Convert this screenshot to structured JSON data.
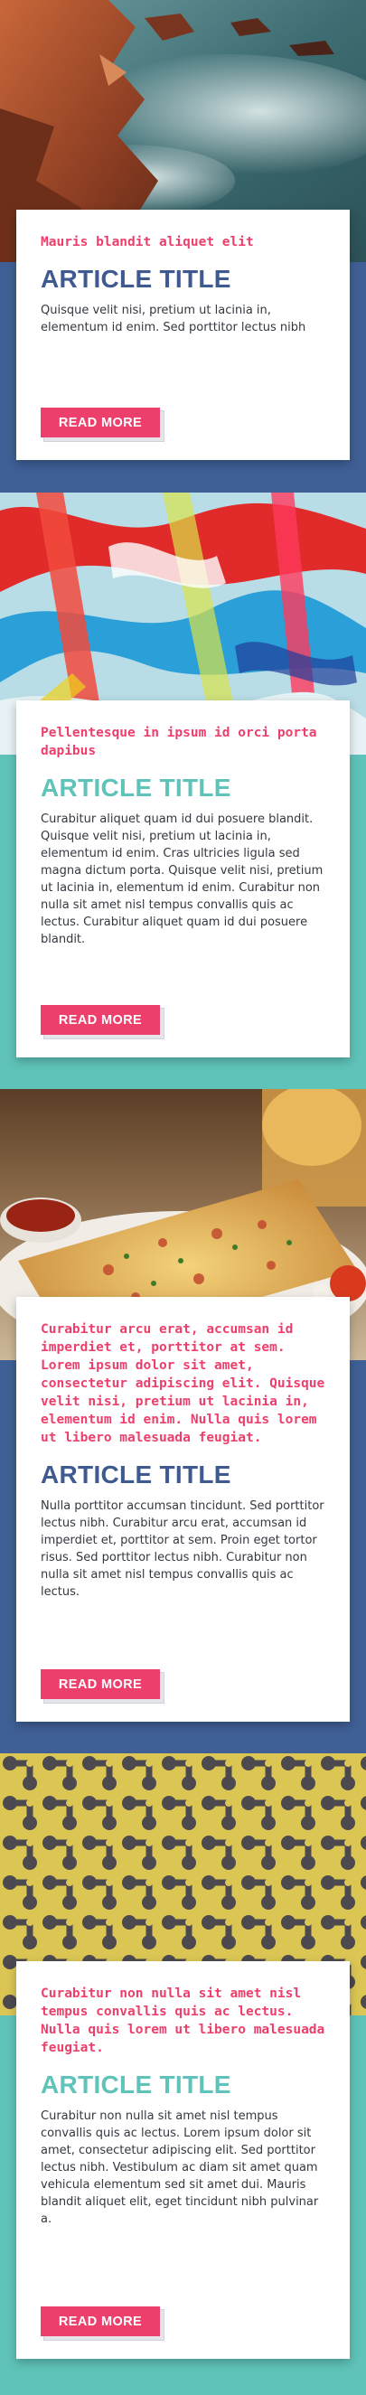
{
  "colors": {
    "navy": "#3f5f96",
    "teal": "#5fc3b9",
    "pink": "#ec3f6b",
    "card": "#ffffff",
    "text": "#333840"
  },
  "articles": [
    {
      "eyebrow": "Mauris blandit aliquet elit",
      "title": "ARTICLE TITLE",
      "body": "Quisque velit nisi, pretium ut lacinia in, elementum id enim. Sed porttitor lectus nibh",
      "button": "READ MORE",
      "image": "coastal-rocks-photo"
    },
    {
      "eyebrow": "Pellentesque in ipsum id orci porta dapibus",
      "title": "ARTICLE TITLE",
      "body": "Curabitur aliquet quam id dui posuere blandit. Quisque velit nisi, pretium ut lacinia in, elementum id enim. Cras ultricies ligula sed magna dictum porta. Quisque velit nisi, pretium ut lacinia in, elementum id enim. Curabitur non nulla sit amet nisl tempus convallis quis ac lectus. Curabitur aliquet quam id dui posuere blandit.",
      "button": "READ MORE",
      "image": "abstract-paint-photo"
    },
    {
      "eyebrow": "Curabitur arcu erat, accumsan id imperdiet et, porttitor at sem. Lorem ipsum dolor sit amet, consectetur adipiscing elit. Quisque velit nisi, pretium ut lacinia in, elementum id enim. Nulla quis lorem ut libero malesuada feugiat.",
      "title": "ARTICLE TITLE",
      "body": "Nulla porttitor accumsan tincidunt. Sed porttitor lectus nibh. Curabitur arcu erat, accumsan id imperdiet et, porttitor at sem. Proin eget tortor risus. Sed porttitor lectus nibh. Curabitur non nulla sit amet nisl tempus convallis quis ac lectus.",
      "button": "READ MORE",
      "image": "pizza-food-photo"
    },
    {
      "eyebrow": "Curabitur non nulla sit amet nisl tempus convallis quis ac lectus. Nulla quis lorem ut libero malesuada feugiat.",
      "title": "ARTICLE TITLE",
      "body": "Curabitur non nulla sit amet nisl tempus convallis quis ac lectus. Lorem ipsum dolor sit amet, consectetur adipiscing elit. Sed porttitor lectus nibh. Vestibulum ac diam sit amet quam vehicula elementum sed sit amet dui. Mauris blandit aliquet elit, eget tincidunt nibh pulvinar a.",
      "button": "READ MORE",
      "image": "yellow-pattern-photo"
    }
  ]
}
